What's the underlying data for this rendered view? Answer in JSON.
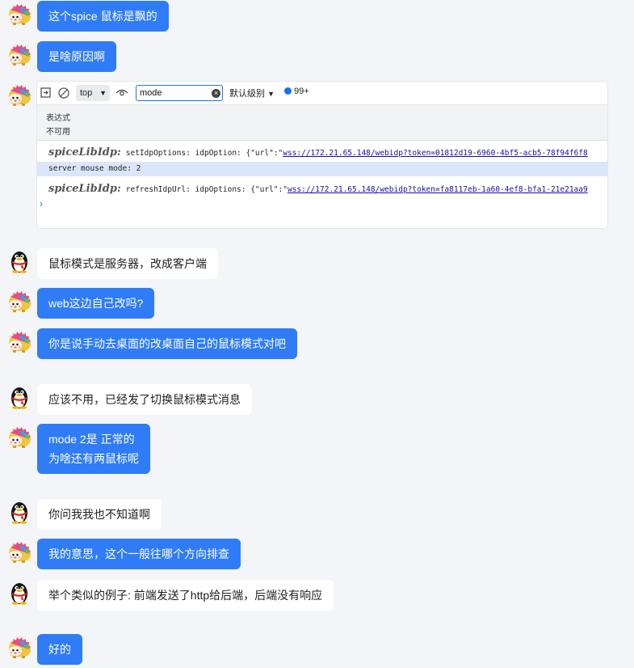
{
  "messages": [
    {
      "id": "m1",
      "sender": "me",
      "avatar": "hedgehog-avatar",
      "lines": [
        "这个spice 鼠标是飘的"
      ]
    },
    {
      "id": "m2",
      "sender": "me",
      "avatar": "hedgehog-avatar",
      "lines": [
        "是啥原因啊"
      ]
    },
    {
      "id": "m3",
      "sender": "me",
      "avatar": "hedgehog-avatar",
      "kind": "screenshot"
    },
    {
      "id": "m4",
      "sender": "other",
      "avatar": "penguin-avatar",
      "lines": [
        "鼠标模式是服务器，改成客户端"
      ]
    },
    {
      "id": "m5",
      "sender": "me",
      "avatar": "hedgehog-avatar",
      "lines": [
        "web这边自己改吗?"
      ]
    },
    {
      "id": "m6",
      "sender": "me",
      "avatar": "hedgehog-avatar",
      "lines": [
        "你是说手动去桌面的改桌面自己的鼠标模式对吧"
      ]
    },
    {
      "id": "m7",
      "sender": "other",
      "avatar": "penguin-avatar",
      "lines": [
        "应该不用，已经发了切换鼠标模式消息"
      ]
    },
    {
      "id": "m8",
      "sender": "me",
      "avatar": "hedgehog-avatar",
      "lines": [
        "mode 2是 正常的",
        "为啥还有两鼠标呢"
      ]
    },
    {
      "id": "m9",
      "sender": "other",
      "avatar": "penguin-avatar",
      "lines": [
        "你问我我也不知道啊"
      ]
    },
    {
      "id": "m10",
      "sender": "me",
      "avatar": "hedgehog-avatar",
      "lines": [
        "我的意思，这个一般往哪个方向排查"
      ]
    },
    {
      "id": "m11",
      "sender": "other",
      "avatar": "penguin-avatar",
      "lines": [
        "举个类似的例子: 前端发送了http给后端，后端没有响应"
      ]
    },
    {
      "id": "m12",
      "sender": "me",
      "avatar": "hedgehog-avatar",
      "lines": [
        "好的"
      ]
    }
  ],
  "devtools": {
    "context": "top",
    "filter_value": "mode",
    "levels_label": "默认级别",
    "issues_count": "99+",
    "live_expression_label": "表达式",
    "live_expression_value": "不可用",
    "logs": [
      {
        "tag": "spiceLibIdp:",
        "text": "setIdpOptions: idpOption: {\"url\":\"",
        "link": "wss://172.21.65.148/webidp?token=01812d19-6960-4bf5-acb5-78f94f6f8"
      },
      {
        "text": "server mouse mode: 2",
        "highlight": true
      },
      {
        "tag": "spiceLibIdp:",
        "text": "refreshIdpUrl: idpOptions: {\"url\":\"",
        "link": "wss://172.21.65.148/webidp?token=fa8117eb-1a60-4ef8-bfa1-21e21aa9"
      }
    ],
    "prompt": "›"
  },
  "colors": {
    "my_bubble": "#2f7cf6",
    "other_bubble": "#ffffff",
    "background": "#f3f5f8"
  }
}
